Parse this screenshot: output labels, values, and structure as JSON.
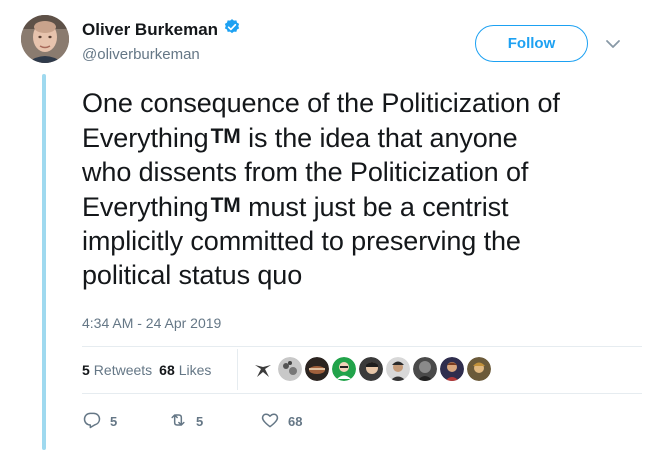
{
  "author": {
    "display_name": "Oliver Burkeman",
    "handle": "@oliverburkeman",
    "verified": true
  },
  "follow_button": {
    "label": "Follow"
  },
  "tweet": {
    "lines": [
      "One consequence of the Politicization of",
      "Everything",
      "is the idea that anyone",
      "who dissents from the Politicization of",
      "Everything",
      "must just be a centrist",
      "implicitly committed to preserving the",
      "political status quo"
    ],
    "tm": "TM",
    "timestamp": "4:34 AM - 24 Apr 2019"
  },
  "stats": {
    "retweets_count": "5",
    "retweets_label": "Retweets",
    "likes_count": "68",
    "likes_label": "Likes"
  },
  "actions": {
    "reply_count": "5",
    "retweet_count": "5",
    "like_count": "68"
  },
  "icons": [
    "verified-badge-icon",
    "chevron-down-icon",
    "reply-icon",
    "retweet-icon",
    "heart-icon"
  ],
  "colors": {
    "brand_blue": "#1da1f2",
    "thread_line": "#9fd9ef",
    "muted_text": "#657786",
    "main_text": "#14171a"
  }
}
